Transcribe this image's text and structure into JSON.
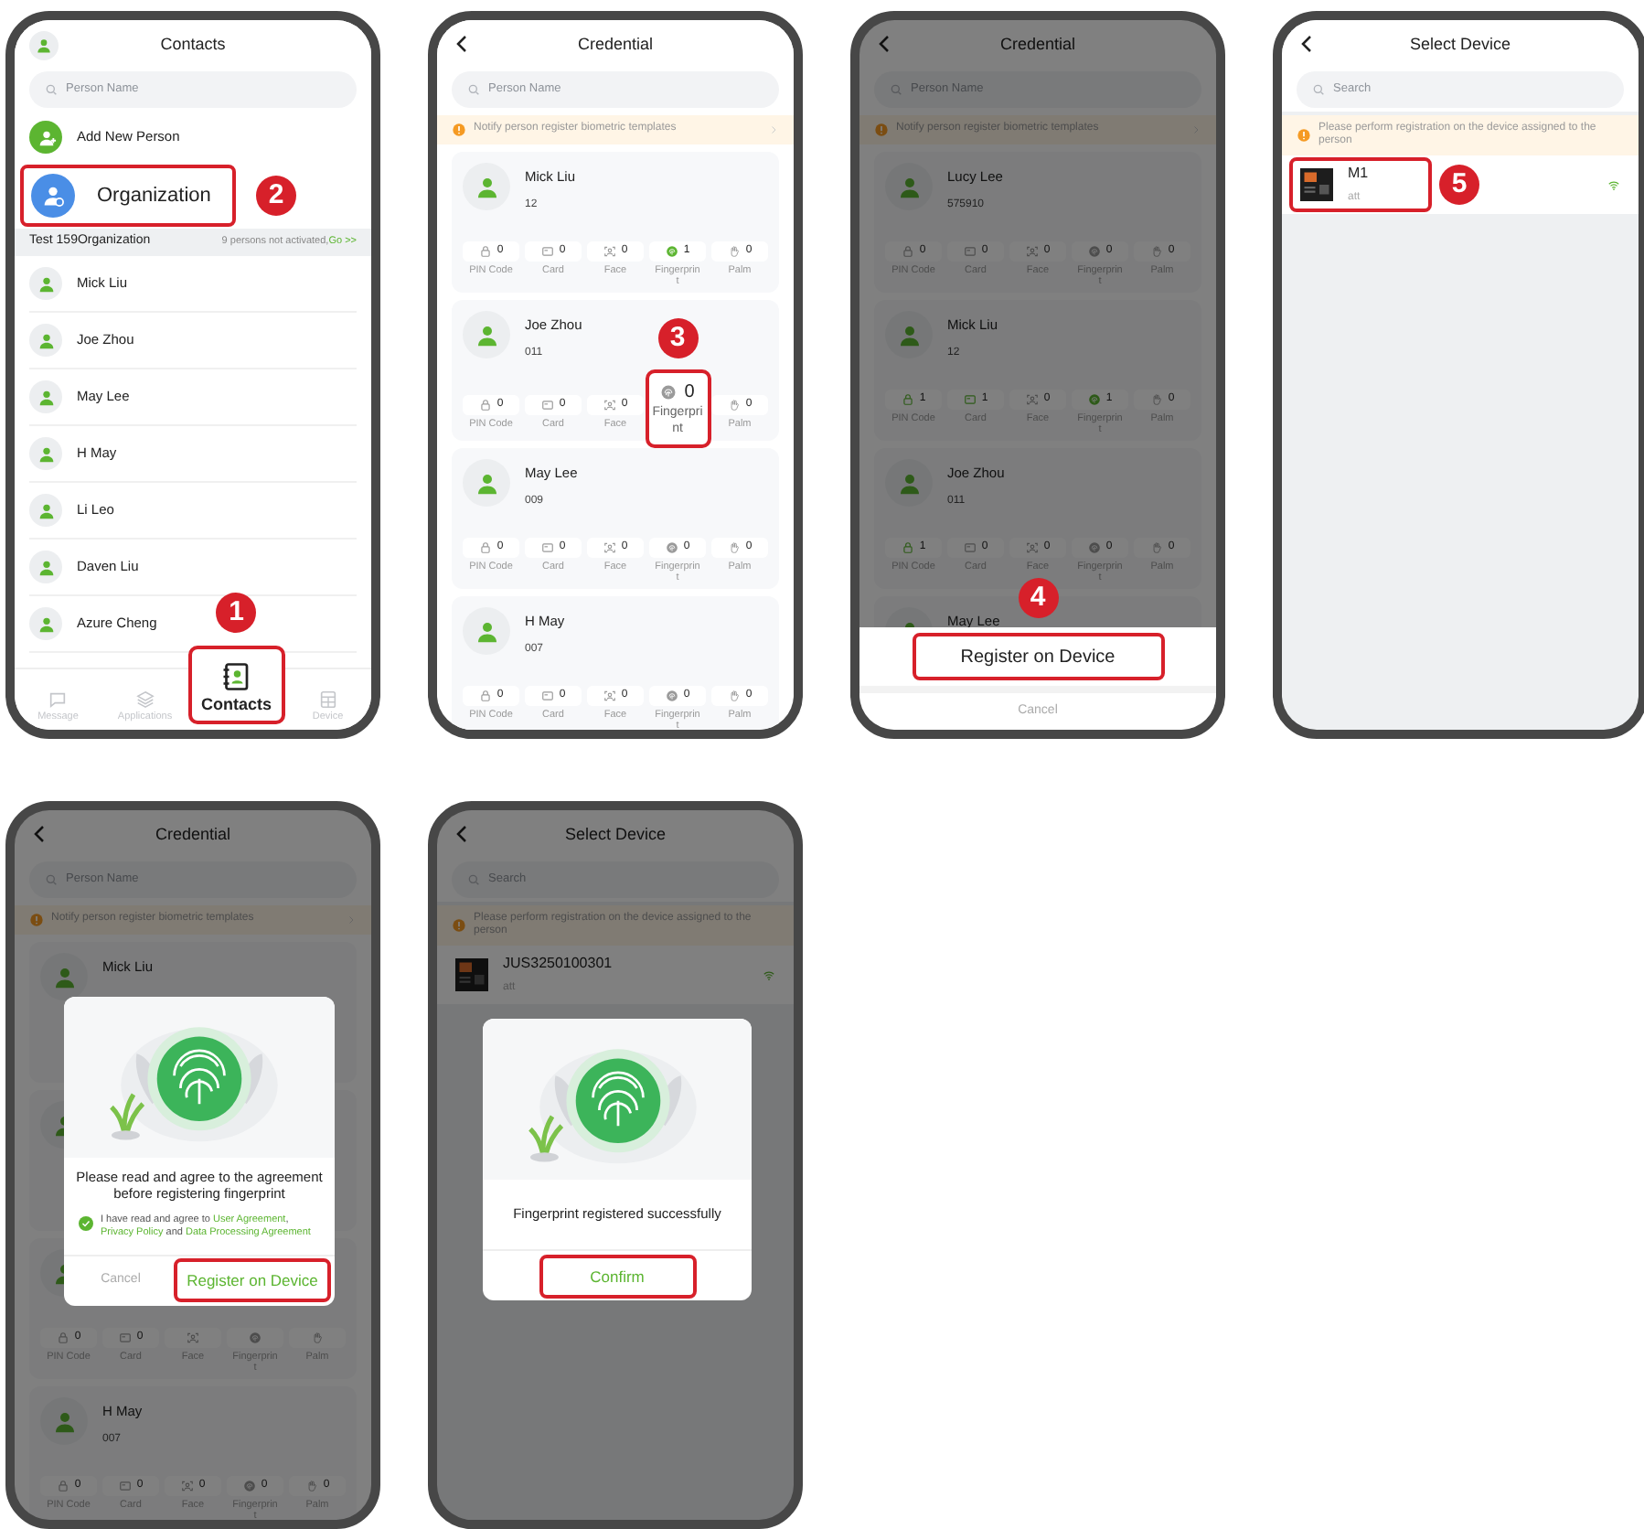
{
  "phones": [
    {
      "kind": "contacts",
      "dimmed": false,
      "header": {
        "title": "Contacts"
      },
      "search": {
        "placeholder": "Person Name"
      },
      "add_person": {
        "label": "Add New Person"
      },
      "organization": {
        "label": "Organization",
        "highlighted": true,
        "step": "2"
      },
      "org_bar": {
        "name": "Test 159Organization",
        "note": "9 persons not activated,",
        "link": "Go >>"
      },
      "contacts": [
        "Mick Liu",
        "Joe Zhou",
        "May Lee",
        "H May",
        "Li Leo",
        "Daven Liu",
        "Azure Cheng"
      ],
      "tabs": [
        {
          "kind": "message",
          "label": "Message",
          "selected": false,
          "highlighted": false
        },
        {
          "kind": "applications",
          "label": "Applications",
          "selected": false,
          "highlighted": false
        },
        {
          "kind": "contacts",
          "label": "Contacts",
          "selected": true,
          "highlighted": true,
          "step": "1"
        },
        {
          "kind": "device",
          "label": "Device",
          "selected": false,
          "highlighted": false
        }
      ]
    },
    {
      "kind": "credential",
      "dimmed": false,
      "header": {
        "title": "Credential"
      },
      "search": {
        "placeholder": "Person Name"
      },
      "notice": "Notify person register biometric templates",
      "cards": [
        {
          "kind": "person",
          "name": "Mick Liu",
          "number": "12",
          "credentials": [
            {
              "kind": "pin",
              "label": "PIN Code",
              "count": "0",
              "registered": false,
              "highlighted": false
            },
            {
              "kind": "card",
              "label": "Card",
              "count": "0",
              "registered": false,
              "highlighted": false
            },
            {
              "kind": "face",
              "label": "Face",
              "count": "0",
              "registered": false,
              "highlighted": false
            },
            {
              "kind": "fingerprint",
              "label": "Fingerprint",
              "count": "1",
              "registered": true,
              "highlighted": false
            },
            {
              "kind": "palm",
              "label": "Palm",
              "count": "0",
              "registered": false,
              "highlighted": false
            }
          ]
        },
        {
          "kind": "person",
          "name": "Joe Zhou",
          "number": "011",
          "credentials": [
            {
              "kind": "pin",
              "label": "PIN Code",
              "count": "0",
              "registered": false,
              "highlighted": false
            },
            {
              "kind": "card",
              "label": "Card",
              "count": "0",
              "registered": false,
              "highlighted": false
            },
            {
              "kind": "face",
              "label": "Face",
              "count": "0",
              "registered": false,
              "highlighted": false
            },
            {
              "kind": "fingerprint",
              "label": "Fingerprint",
              "count": "0",
              "registered": false,
              "highlighted": true,
              "step": "3"
            },
            {
              "kind": "palm",
              "label": "Palm",
              "count": "0",
              "registered": false,
              "highlighted": false
            }
          ]
        },
        {
          "kind": "person",
          "name": "May Lee",
          "number": "009",
          "credentials": [
            {
              "kind": "pin",
              "label": "PIN Code",
              "count": "0",
              "registered": false,
              "highlighted": false
            },
            {
              "kind": "card",
              "label": "Card",
              "count": "0",
              "registered": false,
              "highlighted": false
            },
            {
              "kind": "face",
              "label": "Face",
              "count": "0",
              "registered": false,
              "highlighted": false
            },
            {
              "kind": "fingerprint",
              "label": "Fingerprint",
              "count": "0",
              "registered": false,
              "highlighted": false
            },
            {
              "kind": "palm",
              "label": "Palm",
              "count": "0",
              "registered": false,
              "highlighted": false
            }
          ]
        },
        {
          "kind": "person",
          "name": "H May",
          "number": "007",
          "credentials": [
            {
              "kind": "pin",
              "label": "PIN Code",
              "count": "0",
              "registered": false,
              "highlighted": false
            },
            {
              "kind": "card",
              "label": "Card",
              "count": "0",
              "registered": false,
              "highlighted": false
            },
            {
              "kind": "face",
              "label": "Face",
              "count": "0",
              "registered": false,
              "highlighted": false
            },
            {
              "kind": "fingerprint",
              "label": "Fingerprint",
              "count": "0",
              "registered": false,
              "highlighted": false
            },
            {
              "kind": "palm",
              "label": "Palm",
              "count": "0",
              "registered": false,
              "highlighted": false
            }
          ]
        }
      ]
    },
    {
      "kind": "credential",
      "dimmed": true,
      "header": {
        "title": "Credential"
      },
      "search": {
        "placeholder": "Person Name"
      },
      "notice": "Notify person register biometric templates",
      "cards": [
        {
          "kind": "person",
          "name": "Lucy Lee",
          "number": "575910",
          "credentials": [
            {
              "kind": "pin",
              "label": "PIN Code",
              "count": "0",
              "registered": false,
              "highlighted": false
            },
            {
              "kind": "card",
              "label": "Card",
              "count": "0",
              "registered": false,
              "highlighted": false
            },
            {
              "kind": "face",
              "label": "Face",
              "count": "0",
              "registered": false,
              "highlighted": false
            },
            {
              "kind": "fingerprint",
              "label": "Fingerprint",
              "count": "0",
              "registered": false,
              "highlighted": false
            },
            {
              "kind": "palm",
              "label": "Palm",
              "count": "0",
              "registered": false,
              "highlighted": false
            }
          ]
        },
        {
          "kind": "person",
          "name": "Mick Liu",
          "number": "12",
          "credentials": [
            {
              "kind": "pin",
              "label": "PIN Code",
              "count": "1",
              "registered": true,
              "highlighted": false
            },
            {
              "kind": "card",
              "label": "Card",
              "count": "1",
              "registered": true,
              "highlighted": false
            },
            {
              "kind": "face",
              "label": "Face",
              "count": "0",
              "registered": false,
              "highlighted": false
            },
            {
              "kind": "fingerprint",
              "label": "Fingerprint",
              "count": "1",
              "registered": true,
              "highlighted": false
            },
            {
              "kind": "palm",
              "label": "Palm",
              "count": "0",
              "registered": false,
              "highlighted": false
            }
          ]
        },
        {
          "kind": "person",
          "name": "Joe Zhou",
          "number": "011",
          "credentials": [
            {
              "kind": "pin",
              "label": "PIN Code",
              "count": "1",
              "registered": true,
              "highlighted": false
            },
            {
              "kind": "card",
              "label": "Card",
              "count": "0",
              "registered": false,
              "highlighted": false
            },
            {
              "kind": "face",
              "label": "Face",
              "count": "0",
              "registered": false,
              "highlighted": false
            },
            {
              "kind": "fingerprint",
              "label": "Fingerprint",
              "count": "0",
              "registered": false,
              "highlighted": false
            },
            {
              "kind": "palm",
              "label": "Palm",
              "count": "0",
              "registered": false,
              "highlighted": false
            }
          ]
        },
        {
          "kind": "person",
          "name": "May Lee"
        }
      ],
      "sheet": {
        "buttons": [
          {
            "kind": "primary",
            "label": "Register on Device",
            "highlighted": true,
            "step": "4"
          },
          {
            "kind": "cancel",
            "label": "Cancel",
            "highlighted": false
          }
        ]
      }
    },
    {
      "kind": "select_device",
      "dimmed": false,
      "header": {
        "title": "Select Device"
      },
      "search": {
        "placeholder": "Search"
      },
      "notice": "Please perform registration on the device assigned to the person",
      "devices": [
        {
          "name": "M1",
          "group": "att",
          "online": true,
          "highlighted": true,
          "step": "5"
        }
      ]
    },
    {
      "kind": "credential",
      "dimmed": true,
      "header": {
        "title": "Credential"
      },
      "search": {
        "placeholder": "Person Name"
      },
      "notice": "Notify person register biometric templates",
      "cards": [
        {
          "kind": "person",
          "name": "Mick Liu"
        },
        {
          "kind": "person"
        },
        {
          "kind": "person",
          "credentials": [
            {
              "kind": "pin",
              "label": "PIN Code",
              "count": "0",
              "registered": false,
              "highlighted": false
            },
            {
              "kind": "card",
              "label": "Card",
              "count": "0",
              "registered": false,
              "highlighted": false
            },
            {
              "kind": "face",
              "label": "Face",
              "registered": false,
              "highlighted": false
            },
            {
              "kind": "fingerprint",
              "label": "Fingerprint",
              "registered": false,
              "highlighted": false
            },
            {
              "kind": "palm",
              "label": "Palm",
              "registered": false,
              "highlighted": false
            }
          ]
        },
        {
          "kind": "person",
          "name": "H May",
          "number": "007",
          "credentials": [
            {
              "kind": "pin",
              "label": "PIN Code",
              "count": "0",
              "registered": false,
              "highlighted": false
            },
            {
              "kind": "card",
              "label": "Card",
              "count": "0",
              "registered": false,
              "highlighted": false
            },
            {
              "kind": "face",
              "label": "Face",
              "count": "0",
              "registered": false,
              "highlighted": false
            },
            {
              "kind": "fingerprint",
              "label": "Fingerprint",
              "count": "0",
              "registered": false,
              "highlighted": false
            },
            {
              "kind": "palm",
              "label": "Palm",
              "count": "0",
              "registered": false,
              "highlighted": false
            }
          ]
        }
      ],
      "dialog": {
        "kind": "agreement",
        "message": "Please read and agree to the agreement before registering fingerprint",
        "agreement": {
          "checked": true,
          "parts": [
            {
              "text": "I have read and agree to ",
              "link": false
            },
            {
              "text": "User Agreement",
              "link": true
            },
            {
              "text": ", ",
              "link": false
            },
            {
              "text": "Privacy Policy",
              "link": true
            },
            {
              "text": " and ",
              "link": false
            },
            {
              "text": "Data Processing Agreement",
              "link": true
            }
          ]
        },
        "buttons": [
          {
            "kind": "cancel",
            "label": "Cancel",
            "highlighted": false
          },
          {
            "kind": "primary",
            "label": "Register on Device",
            "highlighted": true
          }
        ]
      }
    },
    {
      "kind": "select_device",
      "dimmed": true,
      "header": {
        "title": "Select Device"
      },
      "search": {
        "placeholder": "Search"
      },
      "notice": "Please perform registration on the device assigned to the person",
      "devices": [
        {
          "name": "JUS3250100301",
          "group": "att",
          "online": true,
          "highlighted": false
        }
      ],
      "dialog": {
        "kind": "success",
        "message": "Fingerprint registered successfully",
        "buttons": [
          {
            "kind": "primary",
            "label": "Confirm",
            "highlighted": true
          }
        ]
      }
    }
  ]
}
